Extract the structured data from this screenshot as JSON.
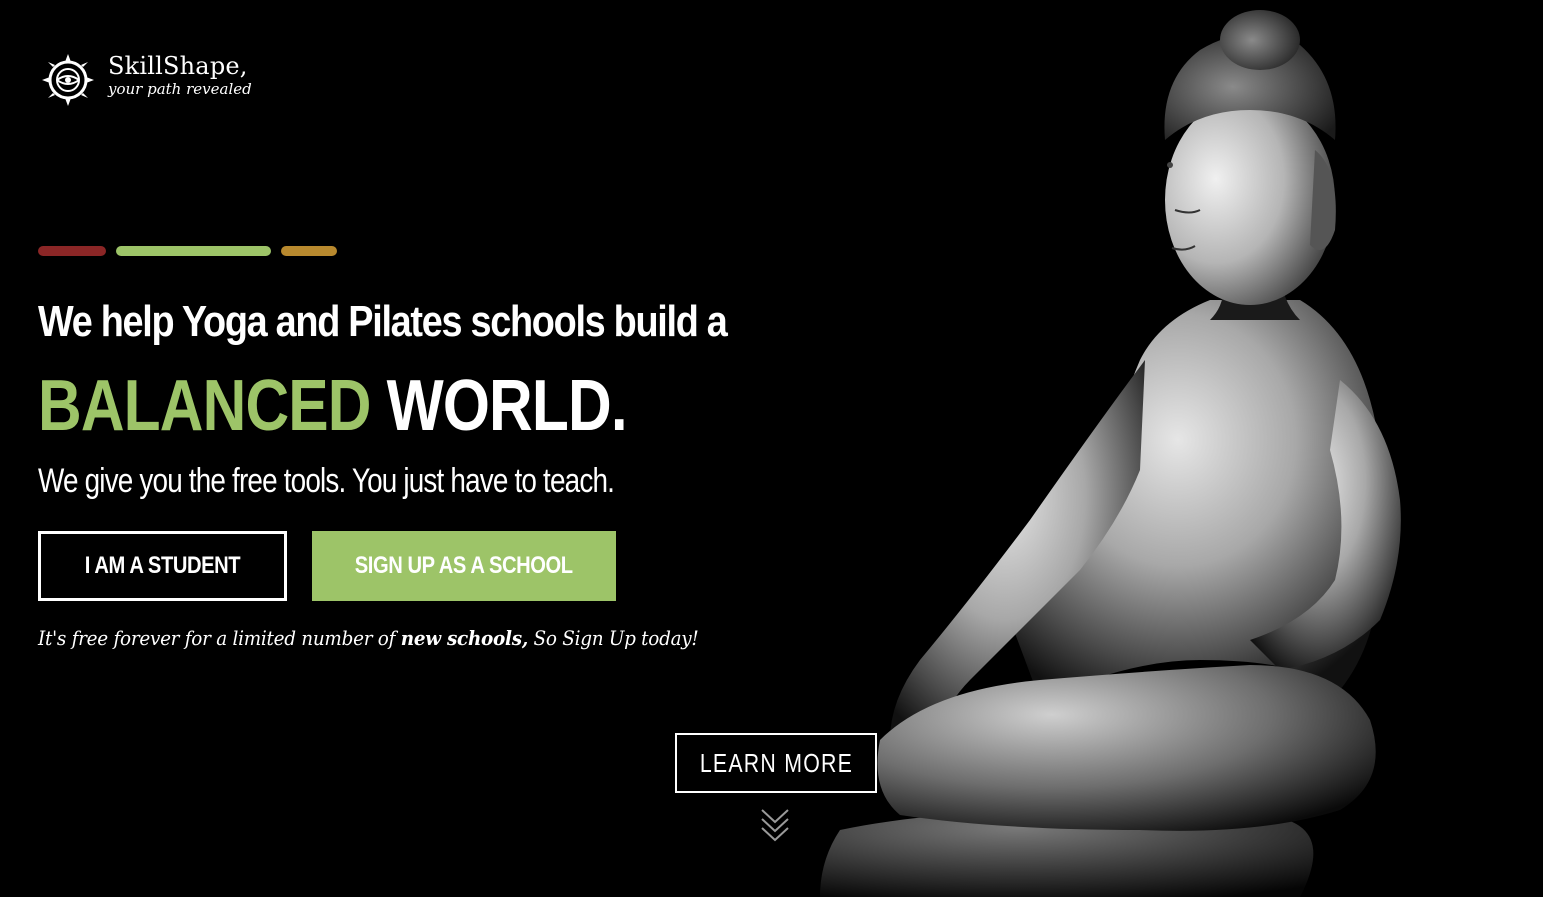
{
  "brand": {
    "name": "SkillShape,",
    "tagline": "your path revealed",
    "logo_icon": "compass-icon"
  },
  "colors": {
    "accent_green": "#9dc468",
    "bar_red": "#8b2626",
    "bar_green": "#9dc468",
    "bar_gold": "#b8892e",
    "background": "#000000"
  },
  "hero": {
    "headline_line1_regular": "We help Yoga and Pilates schools ",
    "headline_line1_bold": "build a",
    "headline_line2_accent": "BALANCED",
    "headline_line2_plain": " WORLD.",
    "subheadline": "We give you the free tools. You just have to teach.",
    "student_button": "I AM A STUDENT",
    "school_button": "SIGN UP AS A SCHOOL",
    "note_prefix": "It's free forever for a limited number of ",
    "note_bold": "new schools,",
    "note_suffix": " So Sign Up today!",
    "learn_more_button": "LEARN MORE",
    "scroll_icon": "double-chevron-down-icon"
  }
}
